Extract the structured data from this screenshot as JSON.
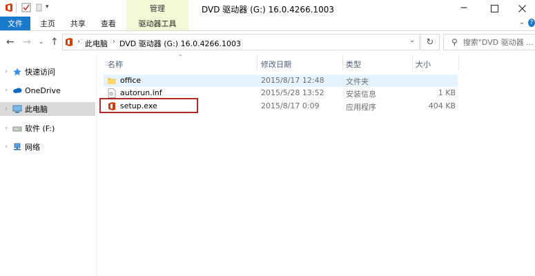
{
  "window": {
    "title": "DVD 驱动器 (G:) 16.0.4266.1003",
    "context_tab": "管理"
  },
  "ribbon": {
    "tabs": [
      "文件",
      "主页",
      "共享",
      "查看",
      "驱动器工具"
    ]
  },
  "address": {
    "path": [
      "此电脑",
      "DVD 驱动器 (G:) 16.0.4266.1003"
    ],
    "search_placeholder": "搜索\"DVD 驱动器 ..."
  },
  "nav": {
    "items": [
      {
        "label": "快速访问",
        "icon": "star-icon"
      },
      {
        "label": "OneDrive",
        "icon": "cloud-icon"
      },
      {
        "label": "此电脑",
        "icon": "computer-icon",
        "selected": true
      },
      {
        "label": "软件 (F:)",
        "icon": "drive-icon"
      },
      {
        "label": "网络",
        "icon": "network-icon"
      }
    ]
  },
  "columns": [
    "名称",
    "修改日期",
    "类型",
    "大小"
  ],
  "files": [
    {
      "name": "office",
      "date": "2015/8/17 12:48",
      "type": "文件夹",
      "size": "",
      "icon": "folder-icon"
    },
    {
      "name": "autorun.inf",
      "date": "2015/5/28 13:52",
      "type": "安装信息",
      "size": "1 KB",
      "icon": "ini-file-icon"
    },
    {
      "name": "setup.exe",
      "date": "2015/8/17 0:09",
      "type": "应用程序",
      "size": "404 KB",
      "icon": "office-app-icon"
    }
  ],
  "colors": {
    "accent": "#1979ca",
    "context_tab": "#f3f9d6",
    "highlight": "#b22828",
    "office_orange": "#d83b01"
  }
}
